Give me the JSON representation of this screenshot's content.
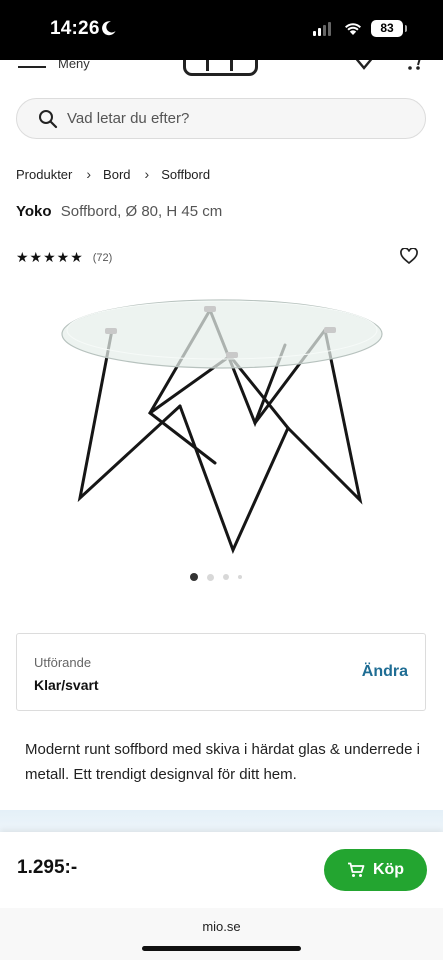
{
  "status_bar": {
    "time": "14:26",
    "battery": "83",
    "icons": [
      "moon-icon",
      "signal-icon",
      "wifi-icon",
      "battery-icon"
    ]
  },
  "header": {
    "menu_label": "Meny",
    "icons": [
      "menu-icon",
      "logo",
      "heart-icon",
      "cart-icon"
    ]
  },
  "search": {
    "placeholder": "Vad letar du efter?"
  },
  "breadcrumb": [
    "Produkter",
    "Bord",
    "Soffbord"
  ],
  "product": {
    "name": "Yoko",
    "description": "Soffbord, Ø 80, H 45 cm",
    "rating_stars": 5,
    "review_count": "(72)",
    "image_count": 4,
    "active_image": 0
  },
  "variant": {
    "label": "Utförande",
    "value": "Klar/svart",
    "change_label": "Ändra"
  },
  "body_text": "Modernt runt soffbord med skiva i härdat glas & underrede i metall. Ett trendigt designval för ditt hem.",
  "buy_bar": {
    "price": "1.295:-",
    "buy_label": "Köp"
  },
  "browser": {
    "url": "mio.se"
  },
  "colors": {
    "accent_link": "#1f6d94",
    "buy_green": "#23a530"
  }
}
